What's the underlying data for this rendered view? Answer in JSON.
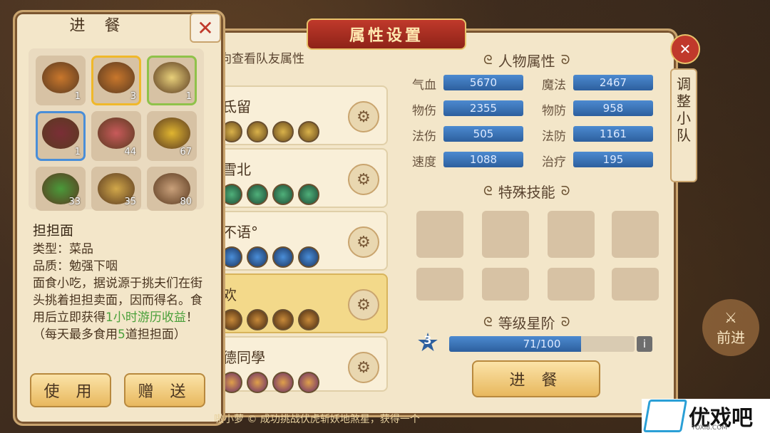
{
  "main": {
    "title": "属性设置",
    "hint": "向查看队友属性",
    "teammates": [
      {
        "name": "氐留",
        "dot_color": "gold"
      },
      {
        "name": "雪北",
        "dot_color": "green"
      },
      {
        "name": "不语°",
        "dot_color": "blue"
      },
      {
        "name": "欢",
        "dot_color": "brown"
      },
      {
        "name": "德同學",
        "dot_color": "purple"
      }
    ],
    "attr_title": "人物属性",
    "attrs": [
      {
        "label": "气血",
        "value": "5670"
      },
      {
        "label": "魔法",
        "value": "2467"
      },
      {
        "label": "物伤",
        "value": "2355"
      },
      {
        "label": "物防",
        "value": "958"
      },
      {
        "label": "法伤",
        "value": "505"
      },
      {
        "label": "法防",
        "value": "1161"
      },
      {
        "label": "速度",
        "value": "1088"
      },
      {
        "label": "治疗",
        "value": "195"
      }
    ],
    "skills_title": "特殊技能",
    "level_title": "等级星阶",
    "level_star": "3",
    "level_progress": "71/100",
    "level_fraction": 0.71,
    "info_label": "i",
    "eat_button": "进 餐"
  },
  "side": {
    "close": "✕",
    "tab_chars": [
      "调",
      "整",
      "小",
      "队"
    ],
    "forward": "前进"
  },
  "food_panel": {
    "title": "进 餐",
    "close": "✕",
    "items": [
      {
        "count": "1",
        "border": "none",
        "color": "#c9772c"
      },
      {
        "count": "3",
        "border": "yellow",
        "color": "#c9772c"
      },
      {
        "count": "1",
        "border": "green",
        "color": "#e8d07a"
      },
      {
        "count": "1",
        "border": "blue",
        "color": "#7a2e36"
      },
      {
        "count": "44",
        "border": "none",
        "color": "#c85a5a"
      },
      {
        "count": "67",
        "border": "none",
        "color": "#e0b530"
      },
      {
        "count": "33",
        "border": "none",
        "color": "#4a9a3a"
      },
      {
        "count": "35",
        "border": "none",
        "color": "#d2a84a"
      },
      {
        "count": "80",
        "border": "none",
        "color": "#c9a07a"
      }
    ],
    "item_name": "担担面",
    "type_line": "类型：菜品",
    "quality_line": "品质：勉强下咽",
    "desc_part1": "面食小吃，据说源于挑夫们在街头挑着担担卖面，因而得名。食用后立即获得",
    "desc_green": "1小时游历收益",
    "desc_part2": "！",
    "limit_part1": "（每天最多食用",
    "limit_green": "5",
    "limit_part2": "道担担面）",
    "use_button": "使 用",
    "gift_button": "赠 送"
  },
  "bottom_tip": "嗷小萝 © 成功挑战伏虎斩妖地煞星，获得一个",
  "watermark": {
    "text": "优戏吧",
    "sub": "YOXI8.COM"
  }
}
